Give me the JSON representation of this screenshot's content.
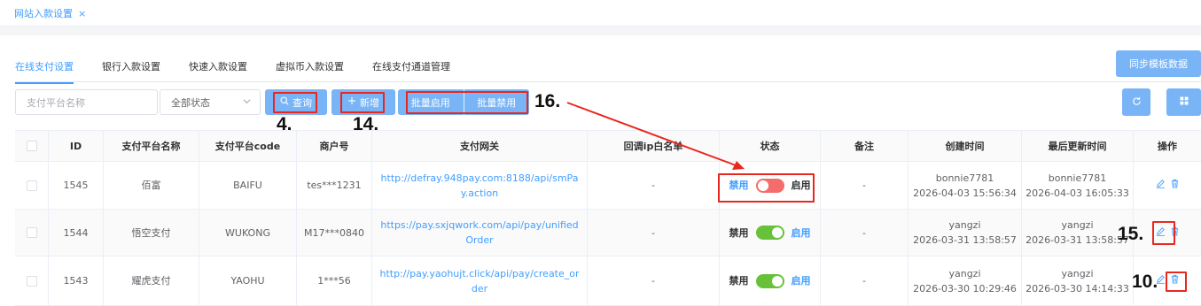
{
  "page_tab": {
    "label": "网站入款设置",
    "close": "×"
  },
  "sub_tabs": [
    {
      "label": "在线支付设置",
      "active": true
    },
    {
      "label": "银行入款设置",
      "active": false
    },
    {
      "label": "快速入款设置",
      "active": false
    },
    {
      "label": "虚拟币入款设置",
      "active": false
    },
    {
      "label": "在线支付通道管理",
      "active": false
    }
  ],
  "sync_button": "同步模板数据",
  "filters": {
    "platform_placeholder": "支付平台名称",
    "status_value": "全部状态"
  },
  "buttons": {
    "query": "查询",
    "add": "新增",
    "batch_enable": "批量启用",
    "batch_disable": "批量禁用"
  },
  "annotations": {
    "query": "4.",
    "add": "14.",
    "batch": "16.",
    "edit": "15.",
    "delete": "10."
  },
  "table": {
    "headers": [
      "ID",
      "支付平台名称",
      "支付平台code",
      "商户号",
      "支付网关",
      "回调ip白名单",
      "状态",
      "备注",
      "创建时间",
      "最后更新时间",
      "操作"
    ],
    "status_off_label": "禁用",
    "status_on_label": "启用",
    "rows": [
      {
        "id": "1545",
        "name": "佰富",
        "code": "BAIFU",
        "merchant": "tes***1231",
        "gateway": "http://defray.948pay.com:8188/api/smPay.action",
        "whitelist": "-",
        "enabled": false,
        "remark": "-",
        "created_by": "bonnie7781",
        "created_at": "2026-04-03 15:56:34",
        "updated_by": "bonnie7781",
        "updated_at": "2026-04-03 16:05:33"
      },
      {
        "id": "1544",
        "name": "悟空支付",
        "code": "WUKONG",
        "merchant": "M17***0840",
        "gateway": "https://pay.sxjqwork.com/api/pay/unifiedOrder",
        "whitelist": "-",
        "enabled": true,
        "remark": "-",
        "created_by": "yangzi",
        "created_at": "2026-03-31 13:58:57",
        "updated_by": "yangzi",
        "updated_at": "2026-03-31 13:58:57"
      },
      {
        "id": "1543",
        "name": "耀虎支付",
        "code": "YAOHU",
        "merchant": "1***56",
        "gateway": "http://pay.yaohujt.click/api/pay/create_order",
        "whitelist": "-",
        "enabled": true,
        "remark": "-",
        "created_by": "yangzi",
        "created_at": "2026-03-30 10:29:46",
        "updated_by": "yangzi",
        "updated_at": "2026-03-30 14:14:33"
      }
    ]
  }
}
